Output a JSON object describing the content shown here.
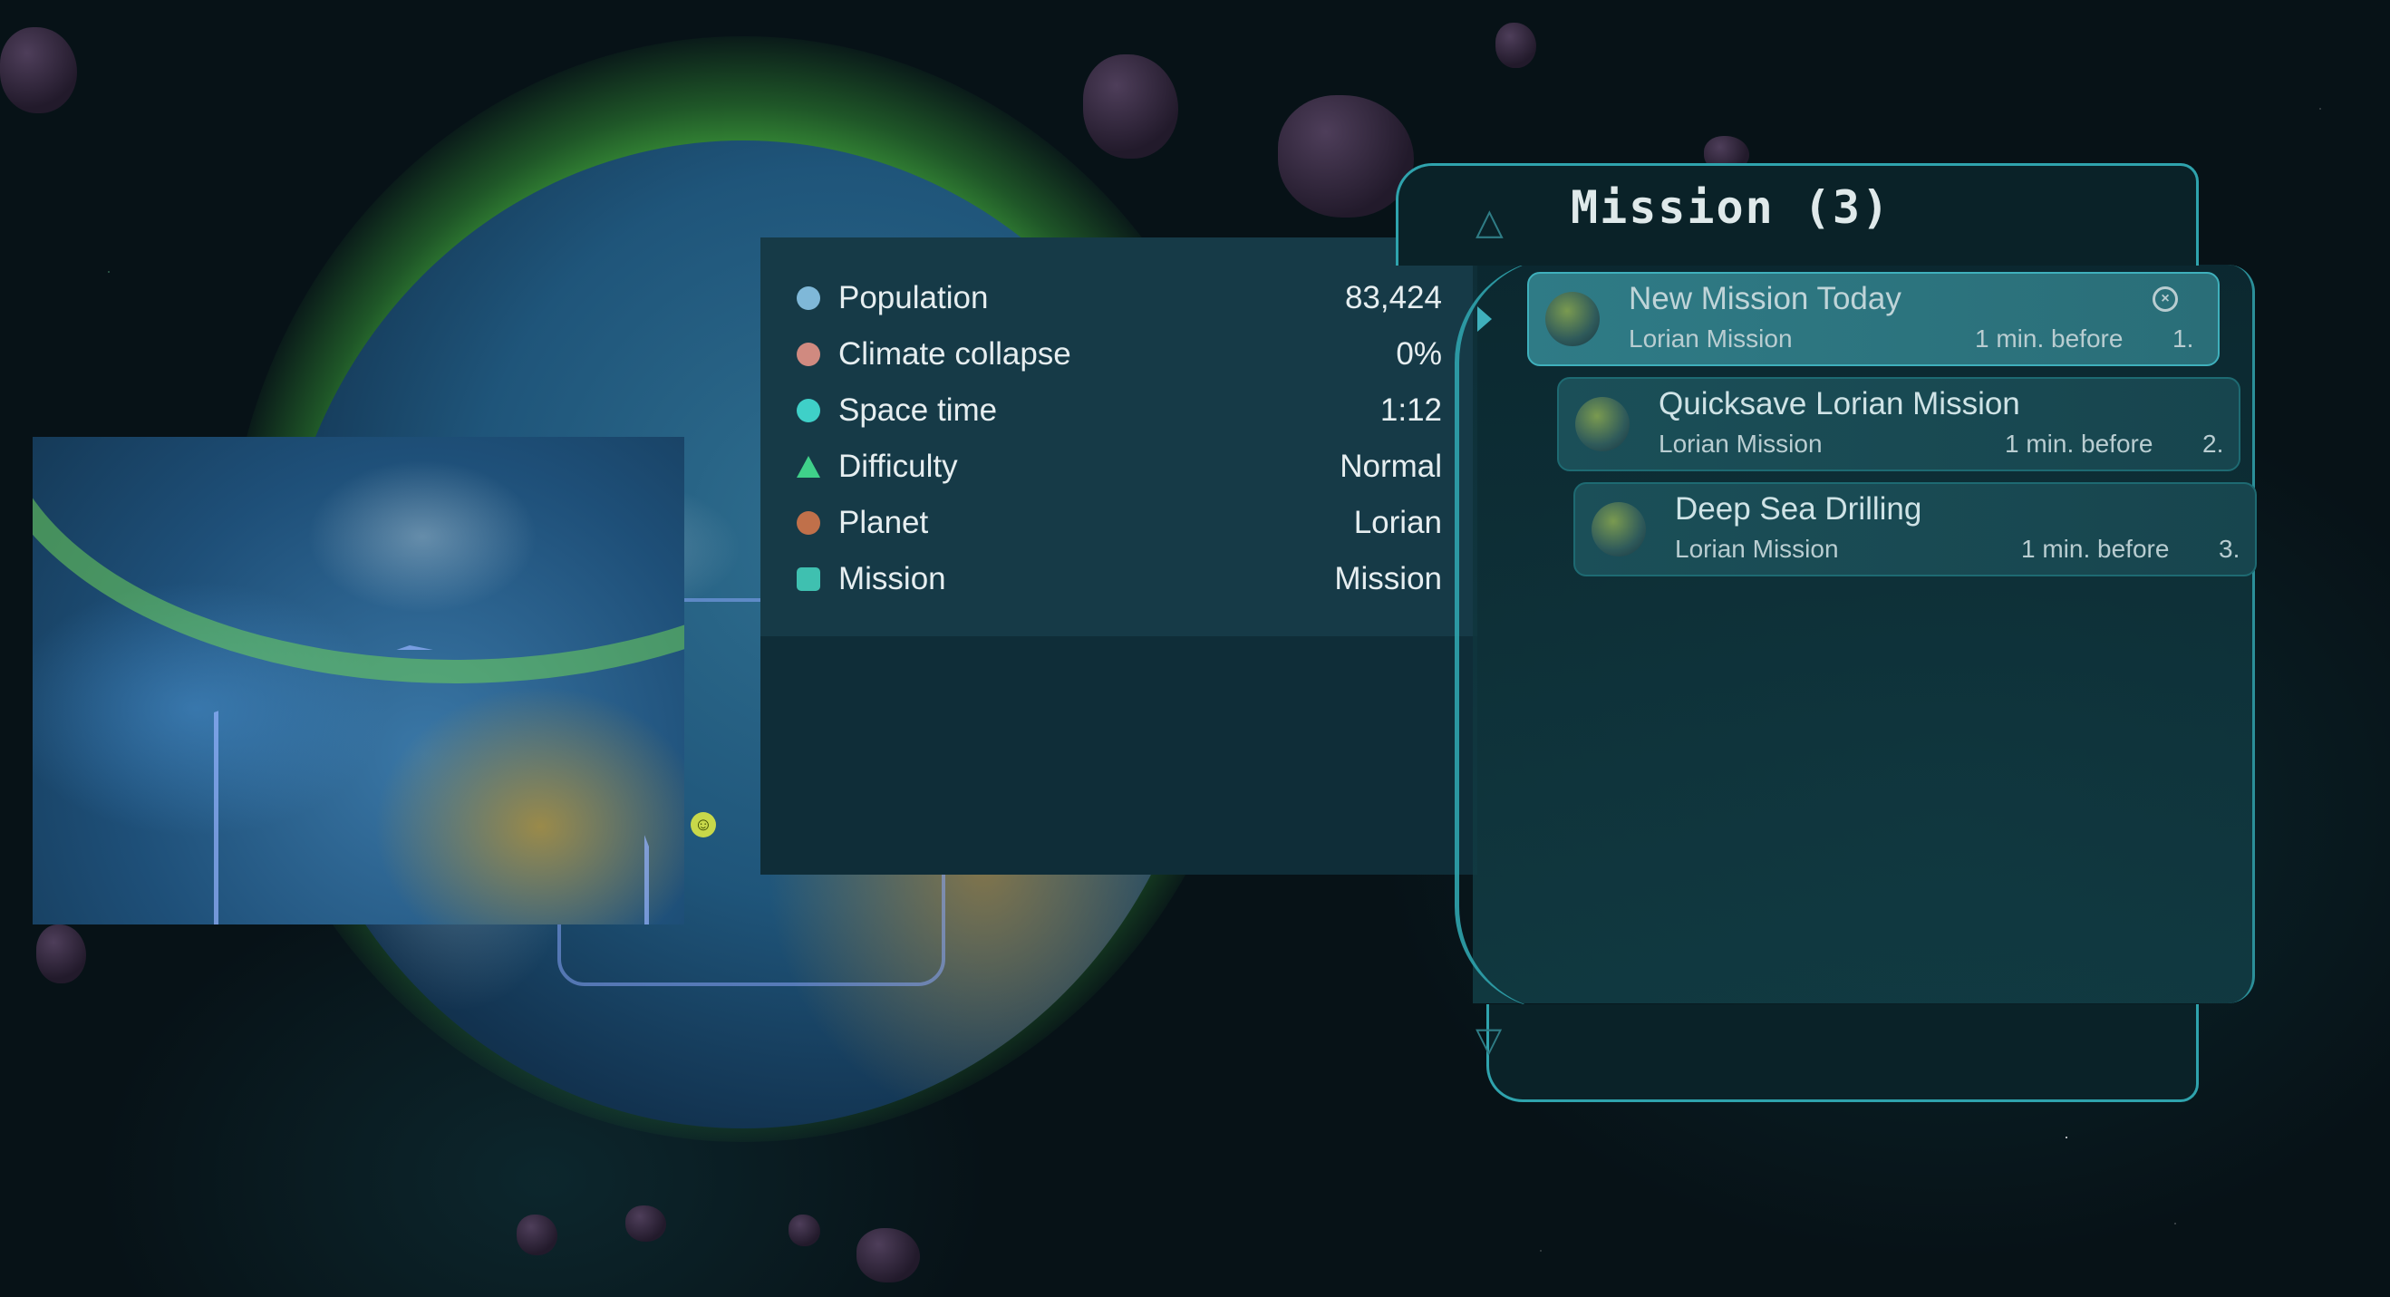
{
  "stats": [
    {
      "icon": "population-icon",
      "label": "Population",
      "value": "83,424",
      "color": "#7fb8d8"
    },
    {
      "icon": "thermometer-icon",
      "label": "Climate collapse",
      "value": "0%",
      "color": "#d08a80"
    },
    {
      "icon": "stopwatch-icon",
      "label": "Space time",
      "value": "1:12",
      "color": "#3fd0c8"
    },
    {
      "icon": "warning-triangle-icon",
      "label": "Difficulty",
      "value": "Normal",
      "color": "#3fd08a"
    },
    {
      "icon": "planet-icon",
      "label": "Planet",
      "value": "Lorian",
      "color": "#c0704a"
    },
    {
      "icon": "mission-icon",
      "label": "Mission",
      "value": "Mission",
      "color": "#3fc0b0"
    }
  ],
  "mission_panel": {
    "title": "Mission (3)",
    "items": [
      {
        "name": "New Mission Today",
        "subtitle": "Lorian Mission",
        "time": "1 min. before",
        "number": "1.",
        "selected": true
      },
      {
        "name": "Quicksave Lorian Mission",
        "subtitle": "Lorian Mission",
        "time": "1 min. before",
        "number": "2.",
        "selected": false
      },
      {
        "name": "Deep Sea Drilling",
        "subtitle": "Lorian Mission",
        "time": "1 min. before",
        "number": "3.",
        "selected": false
      }
    ]
  },
  "colors": {
    "panel_bg": "#163a47",
    "accent": "#2fa3ad",
    "planet_glow": "#5fd04a"
  }
}
